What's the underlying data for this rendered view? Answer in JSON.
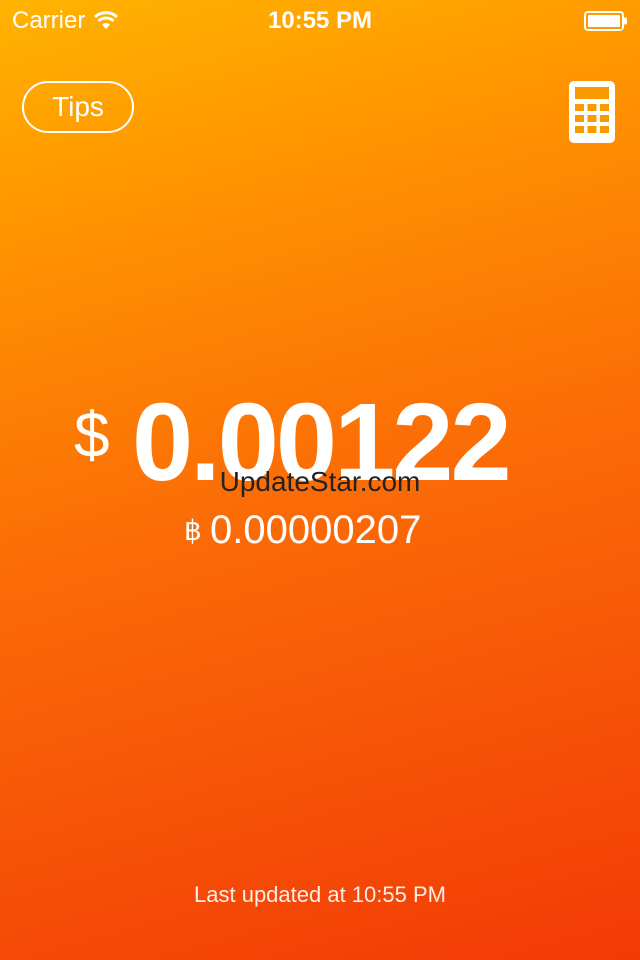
{
  "status_bar": {
    "carrier": "Carrier",
    "time": "10:55 PM",
    "icons": [
      "wifi-icon",
      "battery-icon"
    ]
  },
  "header": {
    "tips_label": "Tips",
    "calculator_icon": "calculator-icon"
  },
  "price": {
    "usd_symbol": "$",
    "usd_value": "0.00122",
    "btc_symbol": "฿",
    "btc_value": "0.00000207"
  },
  "watermark": "UpdateStar.com",
  "footer": {
    "last_updated": "Last updated at 10:55 PM"
  },
  "colors": {
    "gradient_top": "#ffb300",
    "gradient_bottom": "#f23a06",
    "text": "#ffffff"
  }
}
